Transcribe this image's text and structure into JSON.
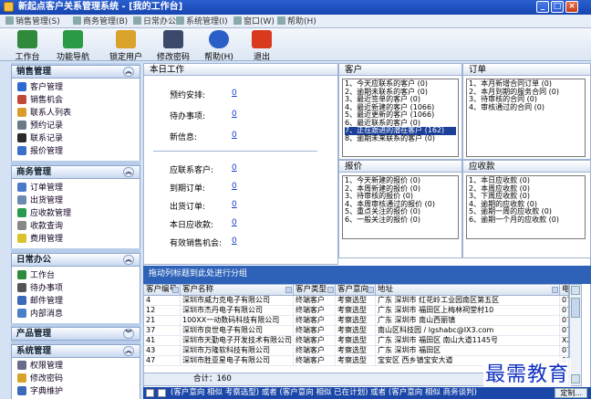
{
  "window": {
    "title": "新起点客户关系管理系统 - [我的工作台]",
    "controls": [
      "_",
      "□",
      "×"
    ]
  },
  "menu": [
    "销售管理(S)",
    "商务管理(B)",
    "日常办公",
    "系统管理(I)",
    "窗口(W)",
    "帮助(H)"
  ],
  "toolbar": [
    {
      "label": "工作台",
      "icon": "desk-icon",
      "color": "#2f8a3c"
    },
    {
      "label": "功能导航",
      "icon": "navigate-arrow-icon",
      "color": "#2a9a44"
    },
    {
      "label": "锁定用户",
      "icon": "key-icon",
      "color": "#d9a22a"
    },
    {
      "label": "修改密码",
      "icon": "users-password-icon",
      "color": "#3b4a6a"
    },
    {
      "label": "帮助(H)",
      "icon": "help-icon",
      "color": "#2b5fc8"
    },
    {
      "label": "退出",
      "icon": "exit-icon",
      "color": "#d93a1e"
    }
  ],
  "sidebar": {
    "sections": [
      {
        "title": "销售管理",
        "items": [
          {
            "label": "客户管理",
            "icon": "customer-icon",
            "color": "#2d6ad0"
          },
          {
            "label": "销售机会",
            "icon": "opportunity-icon",
            "color": "#c04a3a"
          },
          {
            "label": "联系人列表",
            "icon": "contacts-icon",
            "color": "#d99c2a"
          },
          {
            "label": "预约记录",
            "icon": "appointment-icon",
            "color": "#6a7a8a"
          },
          {
            "label": "联系记录",
            "icon": "contact-record-icon",
            "color": "#2a2a2a"
          },
          {
            "label": "报价管理",
            "icon": "quote-icon",
            "color": "#3a70c8"
          }
        ]
      },
      {
        "title": "商务管理",
        "items": [
          {
            "label": "订单管理",
            "icon": "order-icon",
            "color": "#4a7ac8"
          },
          {
            "label": "出货管理",
            "icon": "shipping-icon",
            "color": "#6a8ab0"
          },
          {
            "label": "应收款管理",
            "icon": "receivable-icon",
            "color": "#2a9a50"
          },
          {
            "label": "收款查询",
            "icon": "payment-query-icon",
            "color": "#888"
          },
          {
            "label": "费用管理",
            "icon": "expense-icon",
            "color": "#d9c22a"
          }
        ]
      },
      {
        "title": "日常办公",
        "items": [
          {
            "label": "工作台",
            "icon": "desk-icon",
            "color": "#2f8a3c"
          },
          {
            "label": "待办事项",
            "icon": "todo-icon",
            "color": "#555"
          },
          {
            "label": "邮件管理",
            "icon": "mail-icon",
            "color": "#3a6ab8"
          },
          {
            "label": "内部消息",
            "icon": "message-icon",
            "color": "#4a80c8"
          }
        ]
      },
      {
        "title": "产品管理",
        "items": []
      },
      {
        "title": "系统管理",
        "items": [
          {
            "label": "权限管理",
            "icon": "permission-icon",
            "color": "#6a6a8a"
          },
          {
            "label": "修改密码",
            "icon": "password-icon",
            "color": "#d9a22a"
          },
          {
            "label": "字典维护",
            "icon": "dictionary-icon",
            "color": "#3a6ab8"
          }
        ]
      }
    ]
  },
  "panels": {
    "workbench": {
      "title": "本日工作",
      "top_rows": [
        {
          "label": "预约安排:",
          "value": "0"
        },
        {
          "label": "待办事项:",
          "value": "0"
        },
        {
          "label": "新信息:",
          "value": "0"
        }
      ],
      "bottom_rows": [
        {
          "label": "应联系客户:",
          "value": "0"
        },
        {
          "label": "到期订单:",
          "value": "0"
        },
        {
          "label": "出货订单:",
          "value": "0"
        },
        {
          "label": "本日应收款:",
          "value": "0"
        },
        {
          "label": "有效销售机会:",
          "value": "0"
        }
      ]
    },
    "customer": {
      "title": "客户",
      "items": [
        "1、今天应联系的客户 (0)",
        "2、逾期未联系的客户 (0)",
        "3、最近签单的客户 (0)",
        "4、最近新建的客户 (1066)",
        "5、最近更新的客户 (1066)",
        "6、最近联系的客户 (0)",
        "7、正在跟进的潜在客户 (162)",
        "8、逾期未来联系的客户 (0)"
      ],
      "selected_index": 6
    },
    "order": {
      "title": "订单",
      "items": [
        "1、本月新增合同订单 (0)",
        "2、本月到期的服务合同 (0)",
        "3、待审核的合同 (0)",
        "4、审核通过的合同 (0)"
      ]
    },
    "quote": {
      "title": "报价",
      "items": [
        "1、今天新建的报价 (0)",
        "2、本周新建的报价 (0)",
        "3、待审核的报价 (0)",
        "4、本周审核通过的报价 (0)",
        "5、重点关注的报价 (0)",
        "6、一般关注的报价 (0)"
      ]
    },
    "receivable": {
      "title": "应收款",
      "items": [
        "1、本日应收款 (0)",
        "2、本周应收款 (0)",
        "3、下周应收款 (0)",
        "4、逾期的应收款 (0)",
        "5、逾期一周的应收款 (0)",
        "6、逾期一个月的应收款 (0)"
      ]
    }
  },
  "grid": {
    "group_hint": "拖动列标题到此处进行分组",
    "columns": [
      "客户编号",
      "客户名称",
      "客户类型",
      "客户意向",
      "地址",
      "电"
    ],
    "rows": [
      [
        "4",
        "深圳市威力克电子有限公司",
        "终端客户",
        "考察选型",
        "广东 深圳市 红花岭工业园南区第五区",
        "07"
      ],
      [
        "12",
        "深圳市杰丹电子有限公司",
        "终端客户",
        "考察选型",
        "广东 深圳市 福田区上梅林祠堂村10",
        "07"
      ],
      [
        "21",
        "100XX一动数码科技有限公司",
        "终端客户",
        "考察选型",
        "广东 深圳市 南山西丽镇",
        "07"
      ],
      [
        "37",
        "深圳市良世电子有限公司",
        "终端客户",
        "考察选型",
        "南山区科技园 / lgshabc@IX3.com",
        "07"
      ],
      [
        "41",
        "深圳市天勤电子开发技术有限公司",
        "终端客户",
        "考察选型",
        "广东 深圳市 福田区 南山大道1145号",
        "XX"
      ],
      [
        "43",
        "深圳市万隆软科技有限公司",
        "终端客户",
        "考察选型",
        "广东 深圳市 福田区",
        "07"
      ],
      [
        "47",
        "深圳市胜亚星电子有限公司",
        "终端客户",
        "考察选型",
        "宝安区 西乡镇宝安大道",
        "07"
      ]
    ],
    "total_label": "合计：160"
  },
  "filterbar": {
    "text": "(客户意向 相似 考察选型) 或者 (客户意向 相似 已在计划) 或者 (客户意向 相似 商务谈判)",
    "custom_button": "定制..."
  },
  "watermark": "最需教育"
}
